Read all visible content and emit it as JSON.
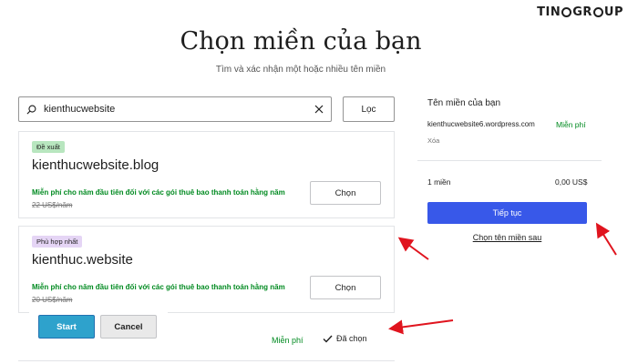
{
  "brand": {
    "logo_left": "TIN",
    "logo_mid": "GR",
    "logo_right": "UP"
  },
  "header": {
    "title": "Chọn miền của bạn",
    "subtitle": "Tìm và xác nhận một hoặc nhiều tên miền"
  },
  "search": {
    "value": "kienthucwebsite",
    "filter_label": "Lọc"
  },
  "results": [
    {
      "badge": "Đề xuất",
      "domain": "kienthucwebsite.blog",
      "promo": "Miễn phí cho năm đầu tiên đối với các gói thuê bao thanh toán hằng năm",
      "old_price": "22 US$/năm",
      "button": "Chọn"
    },
    {
      "badge": "Phù hợp nhất",
      "domain": "kienthuc.website",
      "promo": "Miễn phí cho năm đầu tiên đối với các gói thuê bao thanh toán hằng năm",
      "old_price": "20 US$/năm",
      "button": "Chọn"
    }
  ],
  "overlay": {
    "start": "Start",
    "cancel": "Cancel"
  },
  "bottom_row": {
    "price": "Miễn phí",
    "status": "Đã chọn"
  },
  "sidebar": {
    "title": "Tên miền của bạn",
    "domain": "kienthucwebsite6.wordpress.com",
    "domain_price": "Miễn phí",
    "remove": "Xóa",
    "count": "1 miền",
    "total": "0,00 US$",
    "continue": "Tiếp tục",
    "later": "Chọn tên miền sau"
  },
  "colors": {
    "accent": "#3858e9",
    "free_green": "#008a20",
    "annotation_arrow": "#e0141e",
    "start_button": "#2ea2cc"
  }
}
